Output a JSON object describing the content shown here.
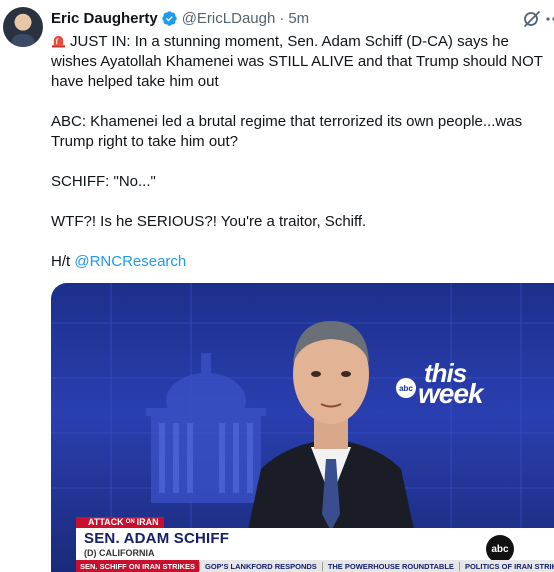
{
  "tweet": {
    "author_name": "Eric Daugherty",
    "handle": "@EricLDaugh",
    "separator": "·",
    "time": "5m",
    "paragraphs": [
      "JUST IN: In a stunning moment, Sen. Adam Schiff (D-CA) says he wishes Ayatollah Khamenei was STILL ALIVE and that Trump should NOT have helped take him out",
      "ABC: Khamenei led a brutal regime that terrorized its own people...was Trump right to take him out?",
      "SCHIFF: \"No...\"",
      "WTF?! Is he SERIOUS?! You're a traitor, Schiff."
    ],
    "ht_prefix": "H/t ",
    "ht_mention": "@RNCResearch",
    "lead_icon": "rotating-light-icon"
  },
  "media": {
    "show_logo_line1": "this",
    "show_logo_line2": "week",
    "show_logo_network": "abc",
    "tag_prefix": "ATTACK",
    "tag_small": "ON",
    "tag_suffix": "IRAN",
    "lower_third_name": "SEN. ADAM SCHIFF",
    "lower_third_sub": "(D) CALIFORNIA",
    "network_badge": "abc",
    "ticker": [
      "SEN. SCHIFF ON IRAN STRIKES",
      "GOP'S LANKFORD RESPONDS",
      "THE POWERHOUSE ROUNDTABLE",
      "POLITICS OF IRAN STRIKES"
    ]
  },
  "colors": {
    "link": "#1d9bf0",
    "verified": "#1d9bf0",
    "text": "#0f1419",
    "muted": "#536471",
    "ticker_red": "#c8102e"
  }
}
